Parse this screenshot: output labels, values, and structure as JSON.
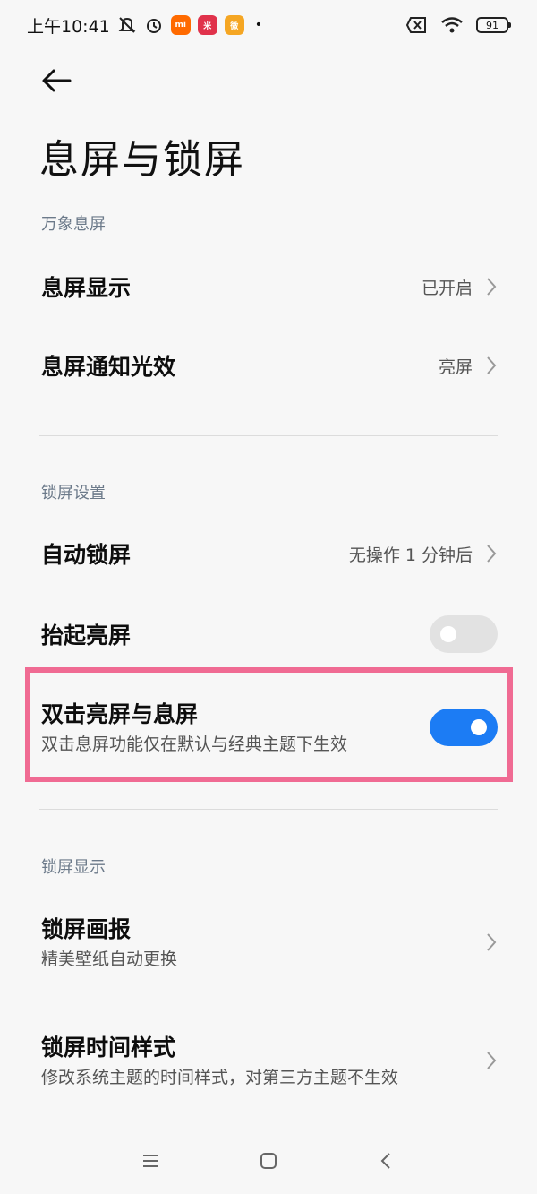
{
  "status": {
    "time": "上午10:41",
    "battery": "91",
    "app_badges": [
      {
        "label": "mi",
        "color": "#ff6a00"
      },
      {
        "label": "米",
        "color": "#e0324b"
      },
      {
        "label": "微",
        "color": "#f5a623"
      }
    ]
  },
  "page": {
    "title": "息屏与锁屏"
  },
  "sections": {
    "aod": {
      "header": "万象息屏",
      "aod_display": {
        "title": "息屏显示",
        "value": "已开启"
      },
      "aod_notify": {
        "title": "息屏通知光效",
        "value": "亮屏"
      }
    },
    "lock": {
      "header": "锁屏设置",
      "auto_lock": {
        "title": "自动锁屏",
        "value": "无操作 1 分钟后"
      },
      "raise_wake": {
        "title": "抬起亮屏",
        "enabled": false
      },
      "double_tap": {
        "title": "双击亮屏与息屏",
        "subtitle": "双击息屏功能仅在默认与经典主题下生效",
        "enabled": true
      }
    },
    "lock_display": {
      "header": "锁屏显示",
      "wallpaper_carousel": {
        "title": "锁屏画报",
        "subtitle": "精美壁纸自动更换"
      },
      "clock_style": {
        "title": "锁屏时间样式",
        "subtitle": "修改系统主题的时间样式，对第三方主题不生效"
      }
    }
  },
  "colors": {
    "accent": "#1c7cf4",
    "highlight": "#f06b93"
  }
}
